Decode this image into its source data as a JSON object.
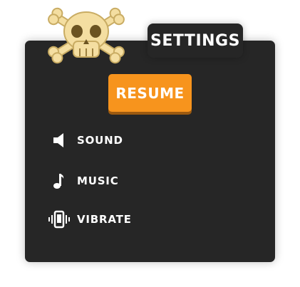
{
  "menu": {
    "title": "SETTINGS",
    "resume_label": "RESUME",
    "options": [
      {
        "label": "SOUND",
        "icon": "speaker-icon"
      },
      {
        "label": "MUSIC",
        "icon": "music-note-icon"
      },
      {
        "label": "VIBRATE",
        "icon": "vibrate-phone-icon"
      }
    ]
  },
  "theme": {
    "panel_color": "#262626",
    "button_color": "#f7941d",
    "skull_color": "#f4dea1",
    "text_color": "#ffffff"
  }
}
